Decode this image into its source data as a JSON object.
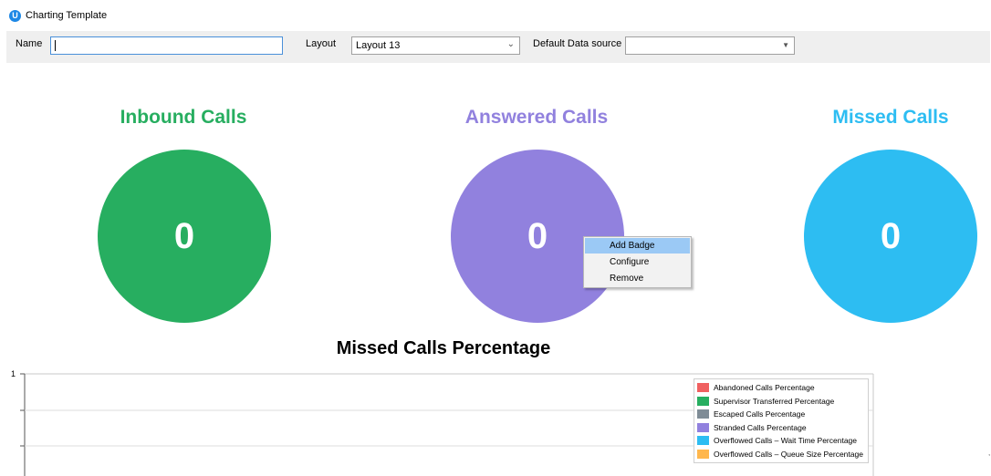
{
  "window": {
    "title": "Charting Template",
    "icon": "u-app-icon"
  },
  "toolbar": {
    "name_label": "Name",
    "name_value": "",
    "layout_label": "Layout",
    "layout_value": "Layout 13",
    "datasource_label": "Default Data source",
    "datasource_value": ""
  },
  "badges": [
    {
      "title": "Inbound Calls",
      "value": "0",
      "color": "#27ae60"
    },
    {
      "title": "Answered Calls",
      "value": "0",
      "color": "#9181de"
    },
    {
      "title": "Missed Calls",
      "value": "0",
      "color": "#2dbdf2"
    }
  ],
  "context_menu": {
    "items": [
      "Add Badge",
      "Configure",
      "Remove"
    ],
    "highlighted": "Add Badge"
  },
  "chart_data": {
    "type": "line",
    "title": "Missed Calls Percentage",
    "yticks": [
      "1"
    ],
    "series": [
      {
        "name": "Abandoned Calls Percentage",
        "color": "#f06060",
        "values": []
      },
      {
        "name": "Supervisor Transferred Percentage",
        "color": "#27ae60",
        "values": []
      },
      {
        "name": "Escaped Calls Percentage",
        "color": "#7f8c96",
        "values": []
      },
      {
        "name": "Stranded Calls Percentage",
        "color": "#9181de",
        "values": []
      },
      {
        "name": "Overflowed Calls – Wait Time Percentage",
        "color": "#2dbdf2",
        "values": []
      },
      {
        "name": "Overflowed Calls – Queue Size Percentage",
        "color": "#ffb74d",
        "values": []
      }
    ],
    "legend_position": "top-right",
    "grid": true
  }
}
